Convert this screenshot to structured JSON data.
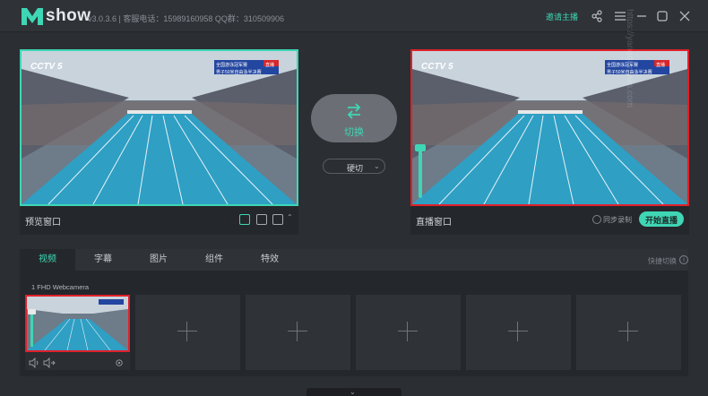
{
  "app": {
    "logo_text": "show",
    "version_line": "v3.0.3.6 | 客服电话：15989160958 QQ群：310509906",
    "invite_label": "邀请主播"
  },
  "titlebar_icons": [
    "share-icon",
    "menu-icon",
    "minimize-icon",
    "maximize-icon",
    "close-icon"
  ],
  "preview": {
    "label": "预览窗口",
    "channel_logo": "CCTV 5",
    "scoreboard_line1": "全国游泳冠军赛",
    "scoreboard_line2": "男子50米自由泳半决赛",
    "live_badge": "直播"
  },
  "live": {
    "label": "直播窗口",
    "sync_label": "同步录制",
    "start_label": "开始直播",
    "channel_logo": "CCTV 5",
    "scoreboard_line1": "全国游泳冠军赛",
    "scoreboard_line2": "男子50米自由泳半决赛",
    "live_badge": "直播"
  },
  "center": {
    "switch_label": "切换",
    "cut_label": "硬切"
  },
  "sources": {
    "tabs": [
      "视频",
      "字幕",
      "图片",
      "组件",
      "特效"
    ],
    "active_tab": "视频",
    "quick_switch_label": "快捷切换",
    "source_title": "1  FHD Webcamera",
    "empty_slots": 5
  },
  "watermark_text": "https://yangqi.imaks.com",
  "colors": {
    "accent": "#3fd6b5",
    "live_red": "#e0202a",
    "background": "#2b2e33",
    "panel": "#24272b"
  }
}
